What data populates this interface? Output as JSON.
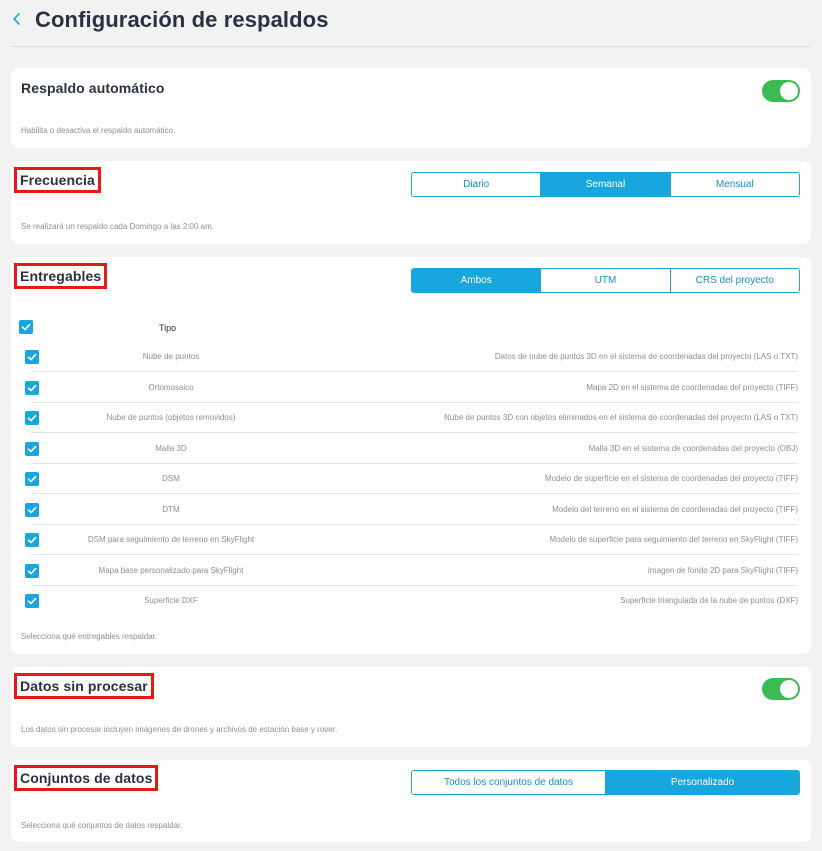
{
  "page": {
    "title": "Configuración de respaldos",
    "back_icon": "chevron-left-icon"
  },
  "auto_backup": {
    "title": "Respaldo automático",
    "description": "Habilita o desactiva el respaldo automático.",
    "enabled": true
  },
  "frequency": {
    "title": "Frecuencia",
    "options": [
      "Diario",
      "Semanal",
      "Mensual"
    ],
    "selected": "Semanal",
    "description": "Se realizará un respaldo cada Domingo a las 2:00 am."
  },
  "deliverables": {
    "title": "Entregables",
    "options": [
      "Ambos",
      "UTM",
      "CRS del proyecto"
    ],
    "selected": "Ambos",
    "header_label": "Tipo",
    "header_checked": true,
    "rows": [
      {
        "type": "Nube de puntos",
        "description": "Datos de nube de puntos 3D en el sistema de coordenadas del proyecto (LAS o TXT)",
        "checked": true
      },
      {
        "type": "Ortomosaico",
        "description": "Mapa 2D en el sistema de coordenadas del proyecto (TIFF)",
        "checked": true
      },
      {
        "type": "Nube de puntos (objetos removidos)",
        "description": "Nube de puntos 3D con objetos eliminados en el sistema de coordenadas del proyecto (LAS o TXT)",
        "checked": true
      },
      {
        "type": "Malla 3D",
        "description": "Malla 3D en el sistema de coordenadas del proyecto (OBJ)",
        "checked": true
      },
      {
        "type": "DSM",
        "description": "Modelo de superficie en el sistema de coordenadas del proyecto (TIFF)",
        "checked": true
      },
      {
        "type": "DTM",
        "description": "Modelo del terreno en el sistema de coordenadas del proyecto (TIFF)",
        "checked": true
      },
      {
        "type": "DSM para seguimiento de terreno en SkyFlight",
        "description": "Modelo de superficie para seguimiento del terreno en SkyFlight (TIFF)",
        "checked": true
      },
      {
        "type": "Mapa base personalizado para SkyFlight",
        "description": "Imagen de fondo 2D para SkyFlight (TIFF)",
        "checked": true
      },
      {
        "type": "Superficie DXF",
        "description": "Superficie triangulada de la nube de puntos (DXF)",
        "checked": true
      }
    ],
    "description": "Selecciona qué entregables respaldar."
  },
  "raw_data": {
    "title": "Datos sin procesar",
    "description": "Los datos sin procesar incluyen imágenes de drones y archivos de estación base y rover.",
    "enabled": true
  },
  "datasets": {
    "title": "Conjuntos de datos",
    "options": [
      "Todos los conjuntos de datos",
      "Personalizado"
    ],
    "selected": "Personalizado",
    "description": "Selecciona qué conjuntos de datos respaldar."
  },
  "colors": {
    "accent": "#17a6de",
    "toggle_on": "#3cba54",
    "highlight_box": "#e61a14"
  }
}
